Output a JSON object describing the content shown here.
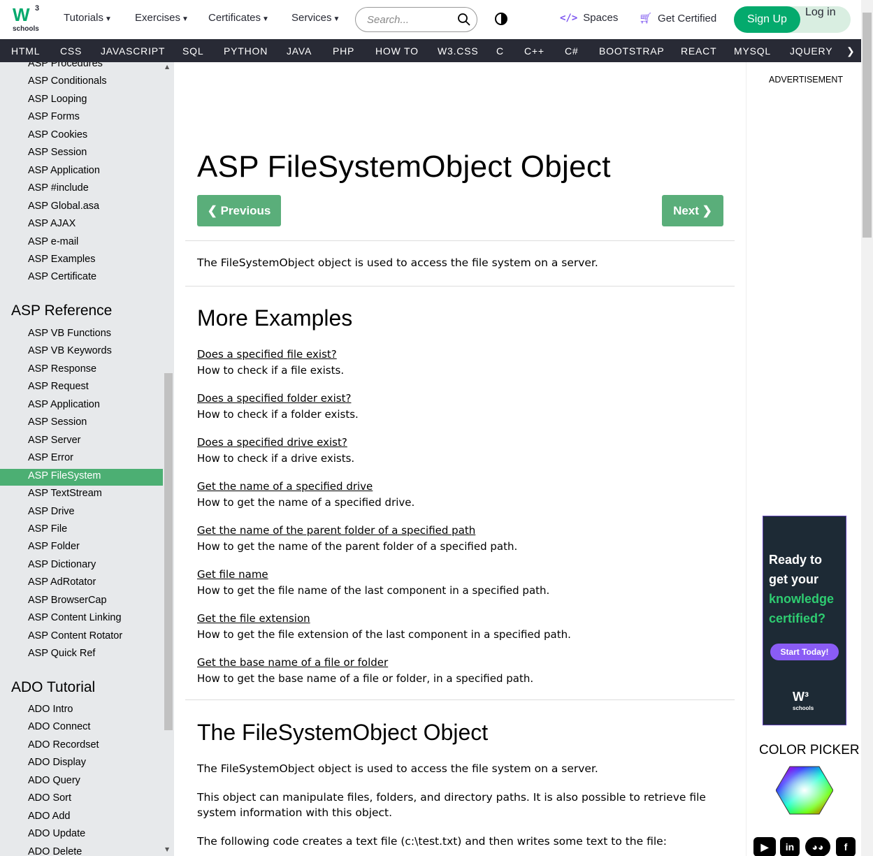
{
  "logo": {
    "w": "W",
    "sup": "3",
    "sub": "schools"
  },
  "topnav": {
    "tutorials": "Tutorials",
    "exercises": "Exercises",
    "certificates": "Certificates",
    "services": "Services",
    "search_placeholder": "Search...",
    "spaces": "Spaces",
    "get_certified": "Get Certified",
    "sign_up": "Sign Up",
    "log_in": "Log in"
  },
  "subnav": [
    "HTML",
    "CSS",
    "JAVASCRIPT",
    "SQL",
    "PYTHON",
    "JAVA",
    "PHP",
    "HOW TO",
    "W3.CSS",
    "C",
    "C++",
    "C#",
    "BOOTSTRAP",
    "REACT",
    "MYSQL",
    "JQUERY",
    "❯"
  ],
  "sidebar": {
    "items_top": [
      "ASP Procedures",
      "ASP Conditionals",
      "ASP Looping",
      "ASP Forms",
      "ASP Cookies",
      "ASP Session",
      "ASP Application",
      "ASP #include",
      "ASP Global.asa",
      "ASP AJAX",
      "ASP e-mail",
      "ASP Examples",
      "ASP Certificate"
    ],
    "heading_reference": "ASP Reference",
    "items_reference": [
      "ASP VB Functions",
      "ASP VB Keywords",
      "ASP Response",
      "ASP Request",
      "ASP Application",
      "ASP Session",
      "ASP Server",
      "ASP Error",
      "ASP FileSystem",
      "ASP TextStream",
      "ASP Drive",
      "ASP File",
      "ASP Folder",
      "ASP Dictionary",
      "ASP AdRotator",
      "ASP BrowserCap",
      "ASP Content Linking",
      "ASP Content Rotator",
      "ASP Quick Ref"
    ],
    "active_index": 8,
    "heading_ado": "ADO Tutorial",
    "items_ado": [
      "ADO Intro",
      "ADO Connect",
      "ADO Recordset",
      "ADO Display",
      "ADO Query",
      "ADO Sort",
      "ADO Add",
      "ADO Update",
      "ADO Delete"
    ]
  },
  "main": {
    "title": "ASP FileSystemObject Object",
    "prev": "❮ Previous",
    "next": "Next ❯",
    "intro": "The FileSystemObject object is used to access the file system on a server.",
    "more_examples": "More Examples",
    "examples": [
      {
        "link": "Does a specified file exist?",
        "desc": "How to check if a file exists."
      },
      {
        "link": "Does a specified folder exist?",
        "desc": "How to check if a folder exists."
      },
      {
        "link": "Does a specified drive exist?",
        "desc": "How to check if a drive exists."
      },
      {
        "link": "Get the name of a specified drive",
        "desc": "How to get the name of a specified drive."
      },
      {
        "link": "Get the name of the parent folder of a specified path",
        "desc": "How to get the name of the parent folder of a specified path."
      },
      {
        "link": "Get file name",
        "desc": "How to get the file name of the last component in a specified path."
      },
      {
        "link": "Get the file extension",
        "desc": "How to get the file extension of the last component in a specified path."
      },
      {
        "link": "Get the base name of a file or folder",
        "desc": "How to get the base name of a file or folder, in a specified path."
      }
    ],
    "fso_heading": "The FileSystemObject Object",
    "fso_p1": "The FileSystemObject object is used to access the file system on a server.",
    "fso_p2a": "This object can manipulate files, folders, and directory paths. It is also possible to retrieve file",
    "fso_p2b": "system information with this object.",
    "fso_p3": "The following code creates a text file (c:\\test.txt) and then writes some text to the file:"
  },
  "right": {
    "ad_label": "ADVERTISEMENT",
    "promo": {
      "l1": "Ready to",
      "l2": "get your",
      "l3": "knowledge",
      "l4": "certified?",
      "cta": "Start Today!",
      "logo": "W³",
      "logo_sub": "schools"
    },
    "color_picker": "COLOR PICKER",
    "social": [
      "youtube-icon",
      "linkedin-icon",
      "discord-icon",
      "facebook-icon"
    ]
  },
  "colors": {
    "brand": "#04AA6D",
    "dark": "#282A35",
    "accent_purple": "#7d56f0"
  }
}
